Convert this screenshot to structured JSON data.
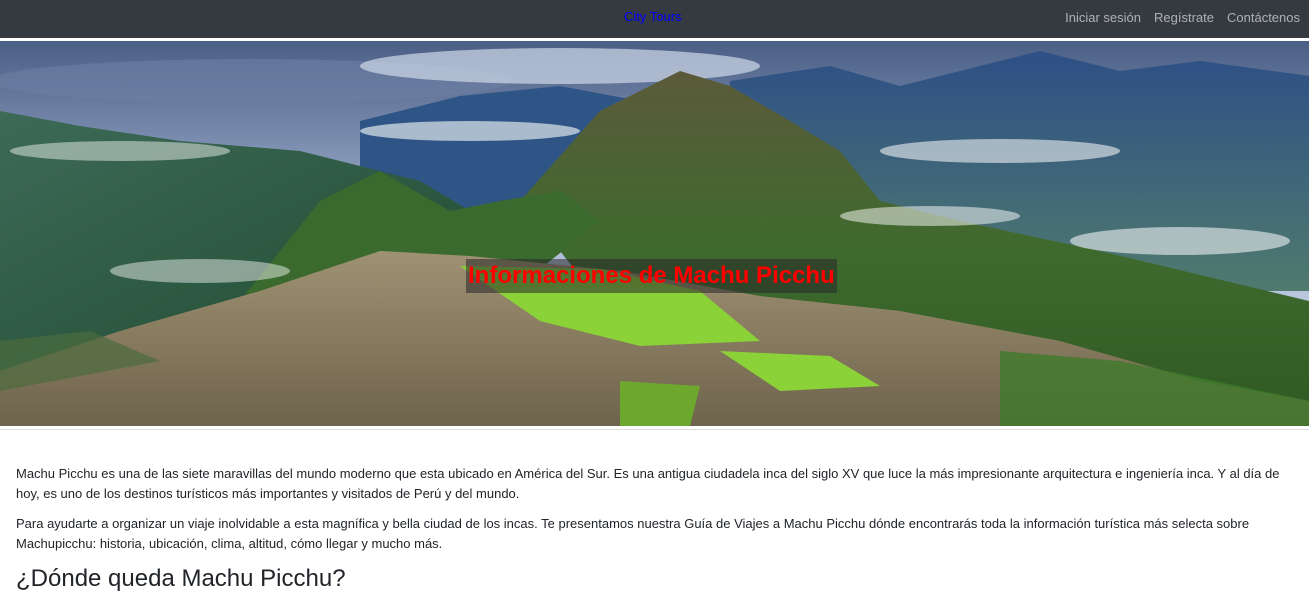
{
  "navbar": {
    "brand": "City Tours",
    "links": [
      "Iniciar sesión",
      "Regístrate",
      "Contáctenos"
    ]
  },
  "hero": {
    "title": "Informaciones de Machu Picchu",
    "image": "machu-picchu-photo"
  },
  "content": {
    "paragraphs": [
      "Machu Picchu es una de las siete maravillas del mundo moderno que esta ubicado en América del Sur. Es una antigua ciudadela inca del siglo XV que luce la más impresionante arquitectura e ingeniería inca. Y al día de hoy, es uno de los destinos turísticos más importantes y visitados de Perú y del mundo.",
      "Para ayudarte a organizar un viaje inolvidable a esta magnífica y bella ciudad de los incas. Te presentamos nuestra Guía de Viajes a Machu Picchu dónde encontrarás toda la información turística más selecta sobre Machupicchu: historia, ubicación, clima, altitud, cómo llegar y mucho más."
    ],
    "heading": "¿Dónde queda Machu Picchu?"
  },
  "colors": {
    "navbar_bg": "#343a40",
    "brand": "#0000ff",
    "hero_title": "#ff0000"
  }
}
